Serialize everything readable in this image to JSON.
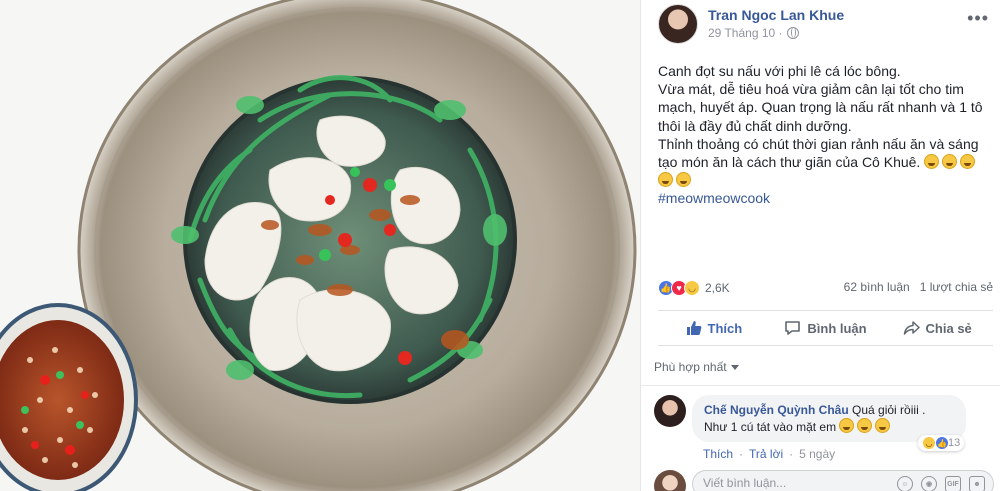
{
  "post": {
    "author": "Tran Ngoc Lan Khue",
    "date": "29 Tháng 10 ·",
    "text_lines": [
      "Canh đọt su nấu với phi lê cá lóc bông.",
      "Vừa mát, dễ tiêu hoá vừa giảm cân lại tốt cho tim mạch, huyết áp. Quan trọng là nấu rất nhanh và 1 tô thôi là đầy đủ chất dinh dưỡng.",
      "Thỉnh thoảng có chút thời gian rảnh nấu ăn và sáng tạo món ăn là cách thư giãn của Cô Khuê."
    ],
    "hashtag": "#meowmeowcook",
    "more_icon": "more-dots-icon"
  },
  "stats": {
    "reactions": "2,6K",
    "comments": "62 bình luận",
    "shares": "1 lượt chia sẻ"
  },
  "actions": {
    "like": "Thích",
    "comment": "Bình luận",
    "share": "Chia sẻ"
  },
  "sort_label": "Phù hợp nhất",
  "comment": {
    "author": "Chế Nguyễn Quỳnh Châu",
    "text_part1": "Quá giỏi rồiii .",
    "text_part2": "Như 1 cú tát vào mặt em",
    "react_count": "13",
    "like": "Thích",
    "reply": "Trả lời",
    "time": "5 ngày"
  },
  "composer": {
    "placeholder": "Viết bình luận..."
  },
  "colors": {
    "link": "#385898",
    "like_active": "#4267b2",
    "muted": "#90949c"
  }
}
